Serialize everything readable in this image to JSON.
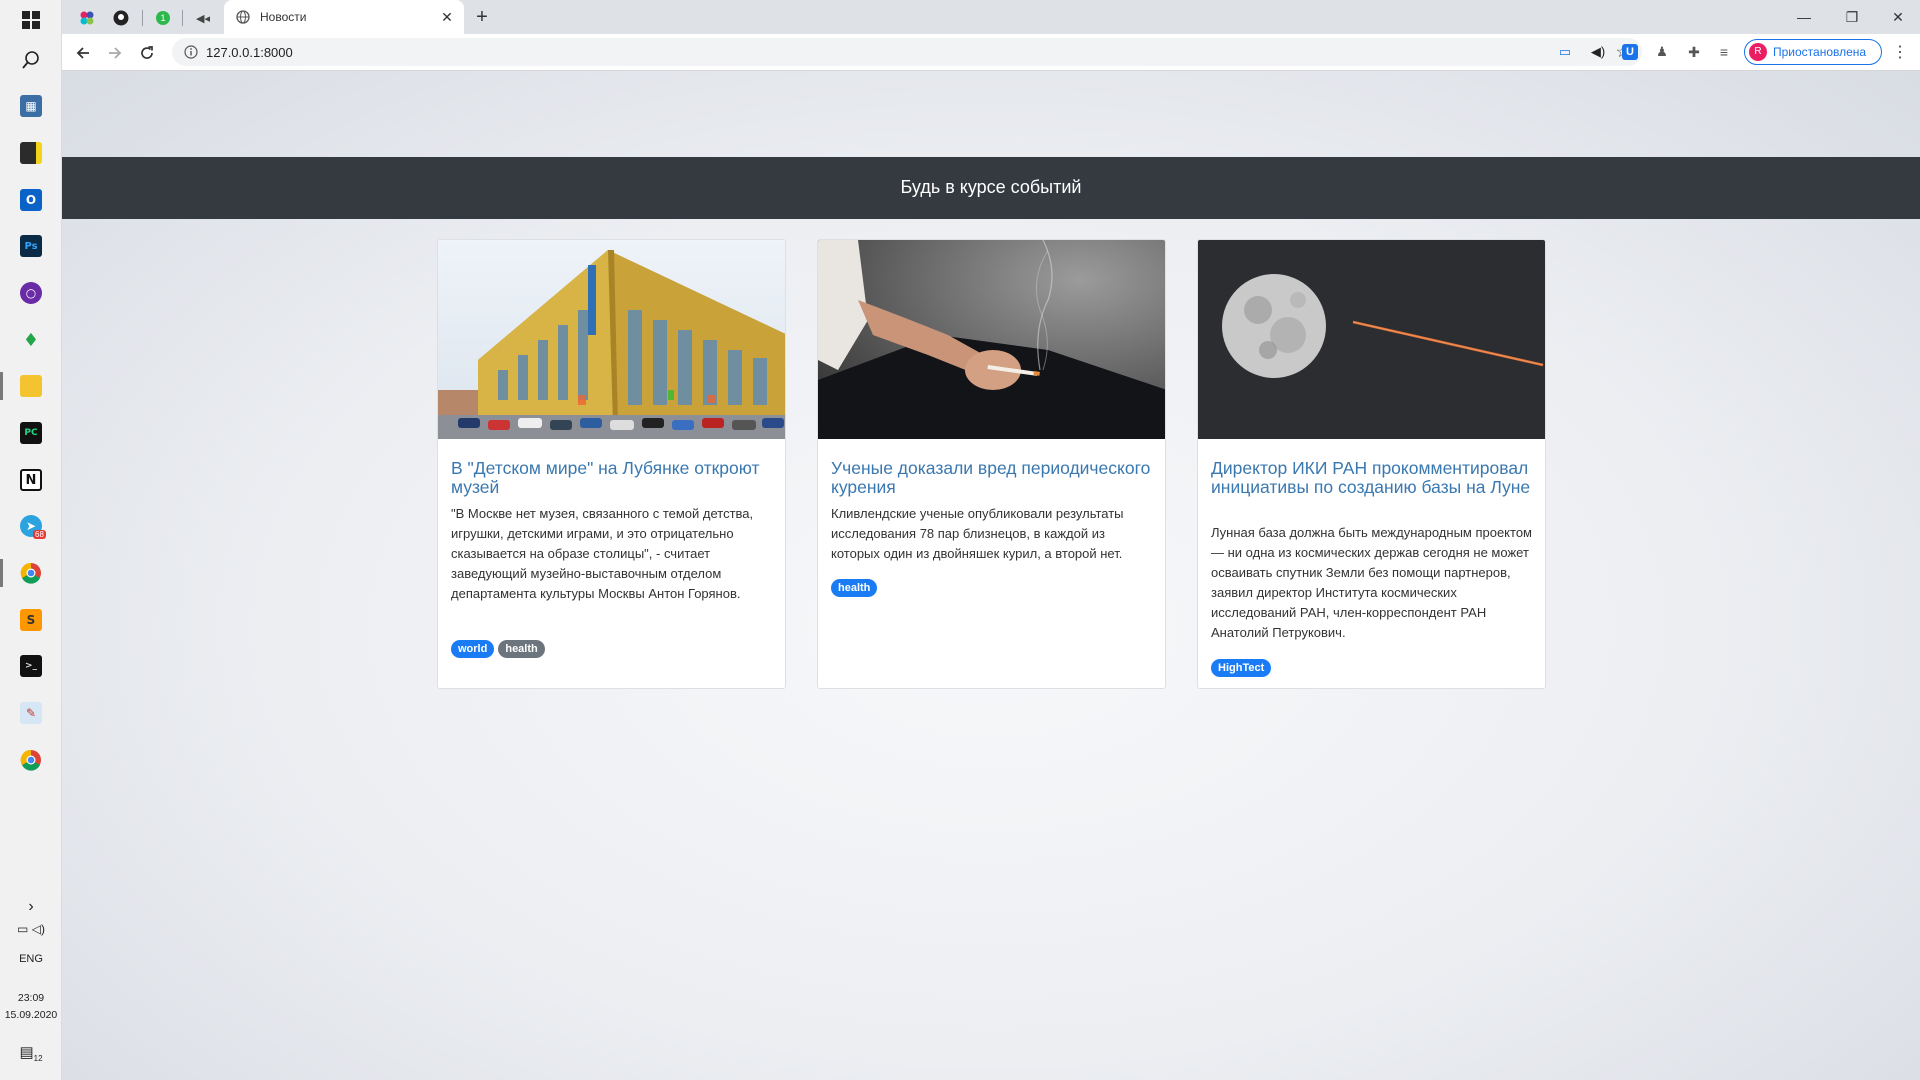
{
  "taskbar": {
    "language": "ENG",
    "time": "23:09",
    "date": "15.09.2020",
    "notification_count": "12",
    "telegram_badge": "68"
  },
  "browser": {
    "tab_title": "Новости",
    "url": "127.0.0.1:8000",
    "profile_initial": "R",
    "profile_label": "Приостановлена"
  },
  "page": {
    "banner_title": "Будь в курсе событий",
    "articles": [
      {
        "title": "В \"Детском мире\" на Лубянке откроют музей",
        "text": "\"В Москве нет музея, связанного с темой детства, игрушки, детскими играми, и это отрицательно сказывается на образе столицы\", - считает заведующий музейно-выставочным отделом департамента культуры Москвы Антон Горянов.",
        "tags": [
          {
            "label": "world",
            "color": "#1a7cf5"
          },
          {
            "label": "health",
            "color": "#6c757d"
          }
        ]
      },
      {
        "title": "Ученые доказали вред периодического курения",
        "text": "Кливлендские ученые опубликовали результаты исследования 78 пар близнецов, в каждой из которых один из двойняшек курил, а второй нет.",
        "tags": [
          {
            "label": "health",
            "color": "#1a7cf5"
          }
        ]
      },
      {
        "title": "Директор ИКИ РАН прокомментировал инициативы по созданию базы на Луне",
        "text": "Лунная база должна быть международным проектом — ни одна из космических держав сегодня не может осваивать спутник Земли без помощи партнеров, заявил директор Института космических исследований РАН, член-корреспондент РАН Анатолий Петрукович.",
        "tags": [
          {
            "label": "HighTect",
            "color": "#1a7cf5"
          }
        ]
      }
    ]
  }
}
